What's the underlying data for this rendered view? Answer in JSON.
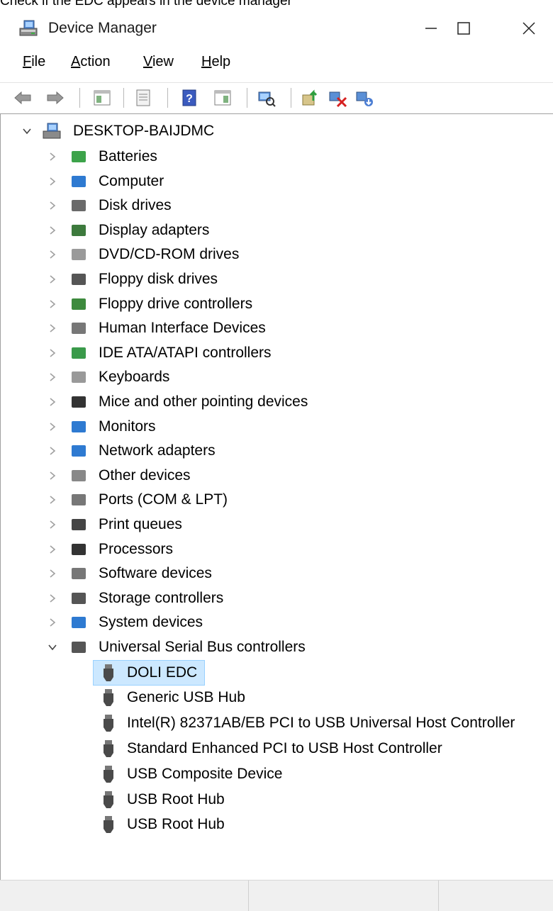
{
  "caption": "Check if the EDC appears in the device manager",
  "window": {
    "title": "Device Manager",
    "controls": [
      "minimize-icon",
      "maximize-icon",
      "close-icon"
    ]
  },
  "menu": {
    "file": {
      "accel": "F",
      "rest": "ile"
    },
    "action": {
      "accel": "A",
      "rest": "ction"
    },
    "view": {
      "accel": "V",
      "rest": "iew"
    },
    "help": {
      "accel": "H",
      "rest": "elp"
    }
  },
  "toolbar": {
    "icons": [
      "back-icon",
      "forward-icon",
      "show-hide-console-tree-icon",
      "properties-icon",
      "help-icon",
      "show-hide-action-pane-icon",
      "scan-hardware-icon",
      "update-driver-icon",
      "disable-device-icon",
      "uninstall-device-icon"
    ]
  },
  "tree": {
    "root": "DESKTOP-BAIJDMC",
    "categories": [
      "Batteries",
      "Computer",
      "Disk drives",
      "Display adapters",
      "DVD/CD-ROM drives",
      "Floppy disk drives",
      "Floppy drive controllers",
      "Human Interface Devices",
      "IDE ATA/ATAPI controllers",
      "Keyboards",
      "Mice and other pointing devices",
      "Monitors",
      "Network adapters",
      "Other devices",
      "Ports (COM & LPT)",
      "Print queues",
      "Processors",
      "Software devices",
      "Storage controllers",
      "System devices",
      "Universal Serial Bus controllers"
    ],
    "usb_children": [
      "DOLI EDC",
      "Generic USB Hub",
      "Intel(R) 82371AB/EB PCI to USB Universal Host Controller",
      "Standard Enhanced PCI to USB Host Controller",
      "USB Composite Device",
      "USB Root Hub",
      "USB Root Hub"
    ],
    "selected": "DOLI EDC"
  },
  "colors": {
    "selection_bg": "#cce8ff",
    "selection_border": "#99d1ff"
  }
}
